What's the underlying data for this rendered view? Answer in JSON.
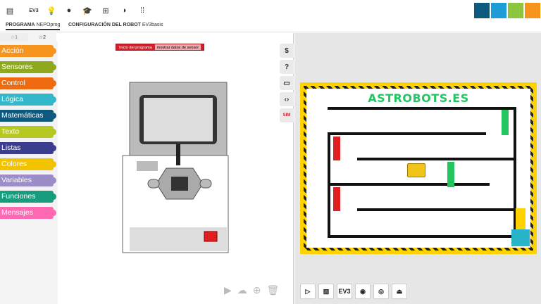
{
  "topbar": {
    "icons": [
      "file-icon",
      "ev3-icon",
      "lightbulb-icon",
      "user-icon",
      "graduation-cap-icon",
      "grid-icon",
      "globe-icon",
      "apps-icon"
    ],
    "ev3_label": "EV3"
  },
  "tabs": {
    "program_label": "PROGRAMA",
    "program_name": "NEPOprog",
    "robot_label": "CONFIGURACIÓN DEL ROBOT",
    "robot_name": "EV3basis"
  },
  "logo": {
    "colors": [
      "#0e5a7e",
      "#1e9cd7",
      "#8cc63f",
      "#f7941d"
    ]
  },
  "toolbox": {
    "tab1": "☆1",
    "tab2": "☆2",
    "categories": [
      {
        "label": "Acción",
        "color": "#f7941d"
      },
      {
        "label": "Sensores",
        "color": "#8fa91e"
      },
      {
        "label": "Control",
        "color": "#ef6b12"
      },
      {
        "label": "Lógica",
        "color": "#33b7c9"
      },
      {
        "label": "Matemáticas",
        "color": "#0e5a7e"
      },
      {
        "label": "Texto",
        "color": "#b5c922"
      },
      {
        "label": "Listas",
        "color": "#3d3d8f"
      },
      {
        "label": "Colores",
        "color": "#f2c300"
      },
      {
        "label": "Variables",
        "color": "#9b8dc7"
      },
      {
        "label": "Funciones",
        "color": "#179c7d"
      },
      {
        "label": "Mensajes",
        "color": "#ff69b4"
      }
    ]
  },
  "start_block": {
    "label": "Inicio del programa",
    "sensor_label": "mostrar datos de sensor"
  },
  "side_tools": {
    "dollar": "$",
    "help": "?",
    "sim": "SIM"
  },
  "arena": {
    "title": "ASTROBOTS.ES"
  },
  "sim_toolbar": {
    "ev3": "EV3"
  }
}
